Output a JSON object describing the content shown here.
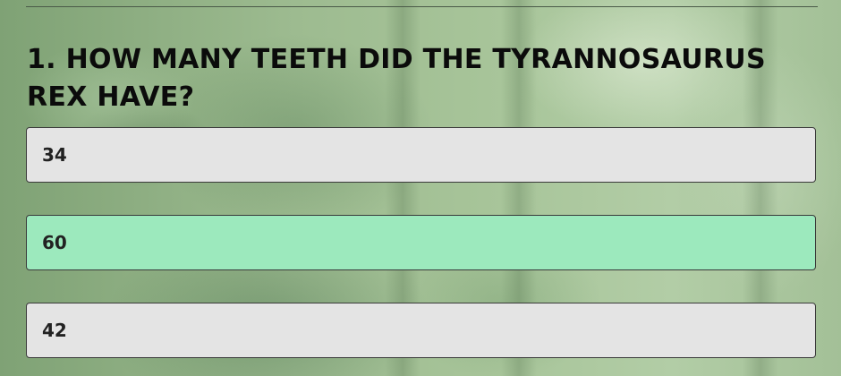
{
  "question": {
    "number": "1.",
    "text": "1. How many teeth did the Tyrannosaurus rex have?"
  },
  "options": [
    {
      "label": "34",
      "selected": false
    },
    {
      "label": "60",
      "selected": true
    },
    {
      "label": "42",
      "selected": false
    }
  ],
  "colors": {
    "option_background": "#e4e4e4",
    "option_selected_background": "#9ce9bd",
    "option_border": "#3a3a3a",
    "question_text": "#0b0b0b"
  }
}
